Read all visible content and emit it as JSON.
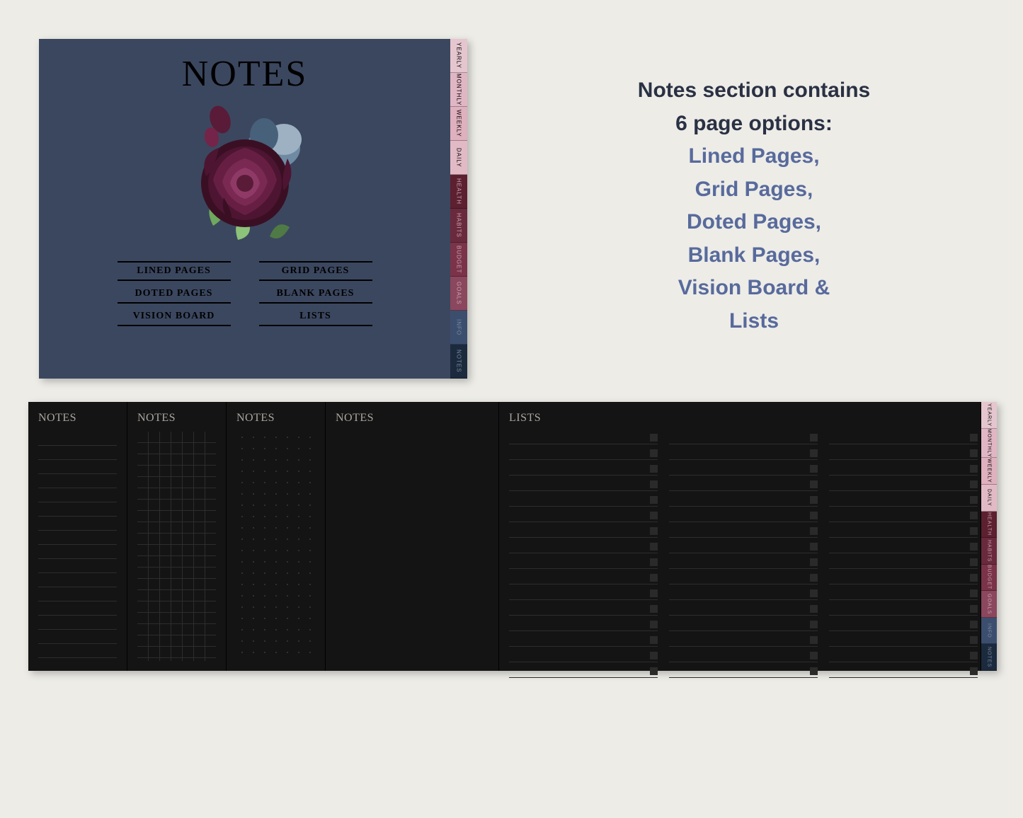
{
  "cover": {
    "title": "NOTES",
    "links": [
      "LINED PAGES",
      "GRID PAGES",
      "DOTED PAGES",
      "BLANK PAGES",
      "VISION BOARD",
      "LISTS"
    ]
  },
  "tabs": [
    {
      "label": "YEARLY",
      "bg": "#e5c6cf"
    },
    {
      "label": "MONTHLY",
      "bg": "#e1b6c4"
    },
    {
      "label": "WEEKLY",
      "bg": "#dfb0be"
    },
    {
      "label": "DAILY",
      "bg": "#e2bac6"
    },
    {
      "label": "HEALTH",
      "bg": "#5c2030",
      "dark": true
    },
    {
      "label": "HABITS",
      "bg": "#6a2a3d",
      "dark": true
    },
    {
      "label": "BUDGET",
      "bg": "#7a3349",
      "dark": true
    },
    {
      "label": "GOALS",
      "bg": "#8a475d",
      "dark": true
    },
    {
      "label": "INFO",
      "bg": "#3c4e6e",
      "dim": true
    },
    {
      "label": "NOTES",
      "bg": "#1c2a3d",
      "dim": true
    }
  ],
  "desc": {
    "l1": "Notes section contains",
    "l2": "6 page options:",
    "opts": [
      "Lined Pages,",
      "Grid Pages,",
      "Doted Pages,",
      "Blank Pages,",
      "Vision Board &",
      "Lists"
    ]
  },
  "panels": {
    "lined": "NOTES",
    "grid": "NOTES",
    "dotted": "NOTES",
    "blank": "NOTES",
    "lists": "LISTS"
  },
  "list_rows": 16
}
